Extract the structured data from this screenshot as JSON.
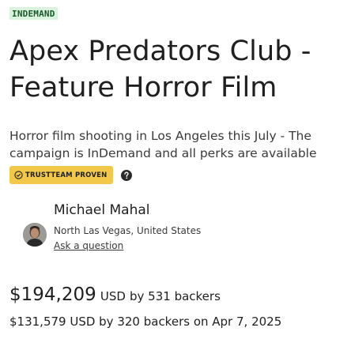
{
  "badge": {
    "label": "INDEMAND"
  },
  "campaign": {
    "title": "Apex Predators Club - Feature Horror Film",
    "subtitle": "Horror film shooting in Los Angeles this July - The campaign is InDemand and all perks are available"
  },
  "trust": {
    "label": "TRUSTTEAM PROVEN"
  },
  "creator": {
    "name": "Michael Mahal",
    "location": "North Las Vegas, United States",
    "ask_label": "Ask a question"
  },
  "funding": {
    "amount": "$194,209",
    "currency": "USD",
    "backers_text": "by 531 backers",
    "previous": "$131,579 USD by 320 backers on Apr 7, 2025"
  },
  "colors": {
    "indemand_bg": "#d9f3de",
    "indemand_text": "#1a5c2a",
    "trust_badge_bg": "#f2c84b"
  }
}
